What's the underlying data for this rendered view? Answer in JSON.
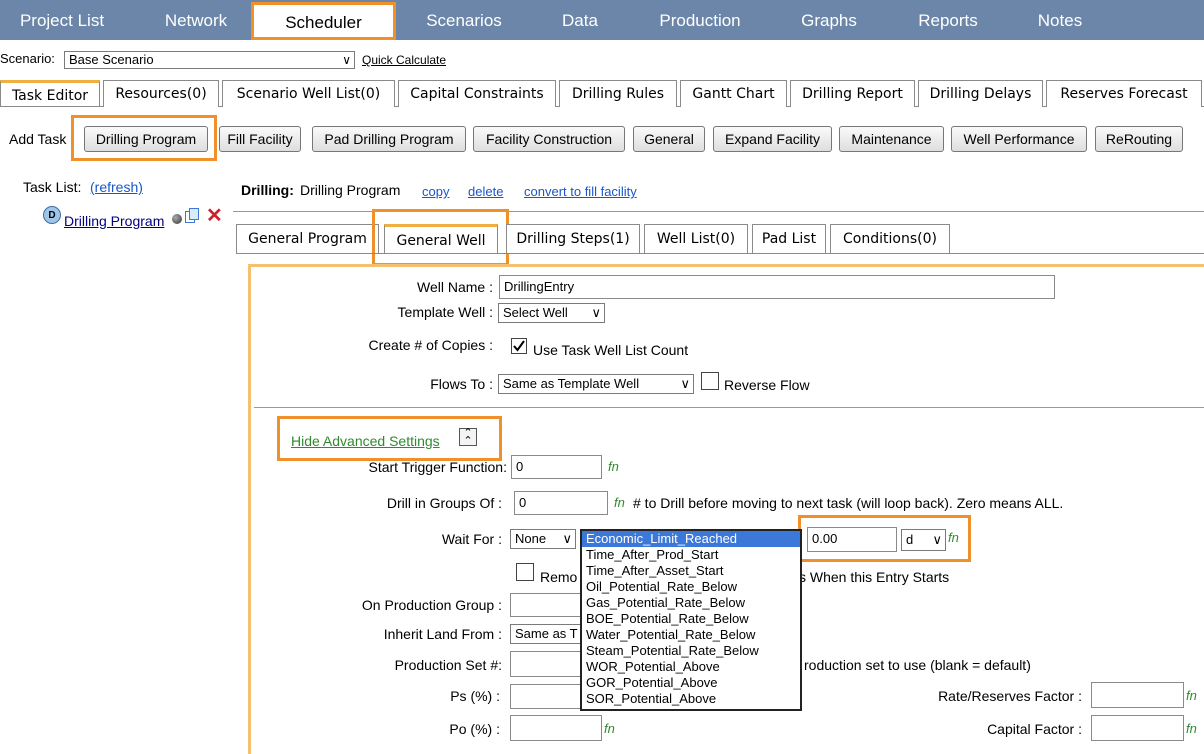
{
  "topnav": {
    "items": [
      "Project List",
      "Network",
      "Scheduler",
      "Scenarios",
      "Data",
      "Production",
      "Graphs",
      "Reports",
      "Notes"
    ]
  },
  "scenario": {
    "label": "Scenario:",
    "value": "Base Scenario",
    "quick_calc": "Quick Calculate"
  },
  "tabs": [
    "Task Editor",
    "Resources(0)",
    "Scenario Well List(0)",
    "Capital Constraints",
    "Drilling Rules",
    "Gantt Chart",
    "Drilling Report",
    "Drilling Delays",
    "Reserves Forecast"
  ],
  "add_task": {
    "label": "Add Task",
    "buttons": [
      "Drilling Program",
      "Fill Facility",
      "Pad Drilling Program",
      "Facility Construction",
      "General",
      "Expand Facility",
      "Maintenance",
      "Well Performance",
      "ReRouting"
    ]
  },
  "task_list": {
    "label": "Task List:",
    "refresh": "(refresh)",
    "badge": "D",
    "item": "Drilling Program"
  },
  "task_header": {
    "prefix": "Drilling:",
    "name": "Drilling Program",
    "copy": "copy",
    "delete": "delete",
    "convert": "convert to fill facility"
  },
  "subtabs": [
    "General Program",
    "General Well",
    "Drilling Steps(1)",
    "Well List(0)",
    "Pad List",
    "Conditions(0)"
  ],
  "form": {
    "well_name_label": "Well Name :",
    "well_name_value": "DrillingEntry",
    "template_label": "Template Well :",
    "template_value": "Select Well",
    "copies_label": "Create # of Copies :",
    "copies_check": "Use Task Well List Count",
    "flows_label": "Flows To :",
    "flows_value": "Same as Template Well",
    "reverse_flow": "Reverse Flow",
    "hide_adv": "Hide Advanced Settings",
    "start_trigger_label": "Start Trigger Function:",
    "start_trigger_value": "0",
    "drill_groups_label": "Drill in Groups Of :",
    "drill_groups_value": "0",
    "drill_groups_note": "# to Drill before moving to next task (will loop back). Zero means ALL.",
    "wait_label": "Wait For :",
    "wait_value": "None",
    "wait_amount": "0.00",
    "wait_unit": "d",
    "remove_prefix": "Remo",
    "remove_suffix": "s When this Entry Starts",
    "on_prod_label": "On Production Group :",
    "inherit_label": "Inherit Land From :",
    "inherit_value": "Same as T",
    "prod_set_label": "Production Set #:",
    "prod_set_note": "roduction set to use (blank = default)",
    "ps_label": "Ps (%) :",
    "po_label": "Po (%) :",
    "rate_factor_label": "Rate/Reserves Factor :",
    "capital_factor_label": "Capital Factor :",
    "fn": "fn"
  },
  "dropdown": [
    "Economic_Limit_Reached",
    "Time_After_Prod_Start",
    "Time_After_Asset_Start",
    "Oil_Potential_Rate_Below",
    "Gas_Potential_Rate_Below",
    "BOE_Potential_Rate_Below",
    "Water_Potential_Rate_Below",
    "Steam_Potential_Rate_Below",
    "WOR_Potential_Above",
    "GOR_Potential_Above",
    "SOR_Potential_Above"
  ],
  "colors": {
    "nav_bg": "#6b86a8",
    "highlight": "#f0902a",
    "link": "#1a56c8",
    "fn_green": "#2f8a2f",
    "selected": "#3b78d8"
  }
}
